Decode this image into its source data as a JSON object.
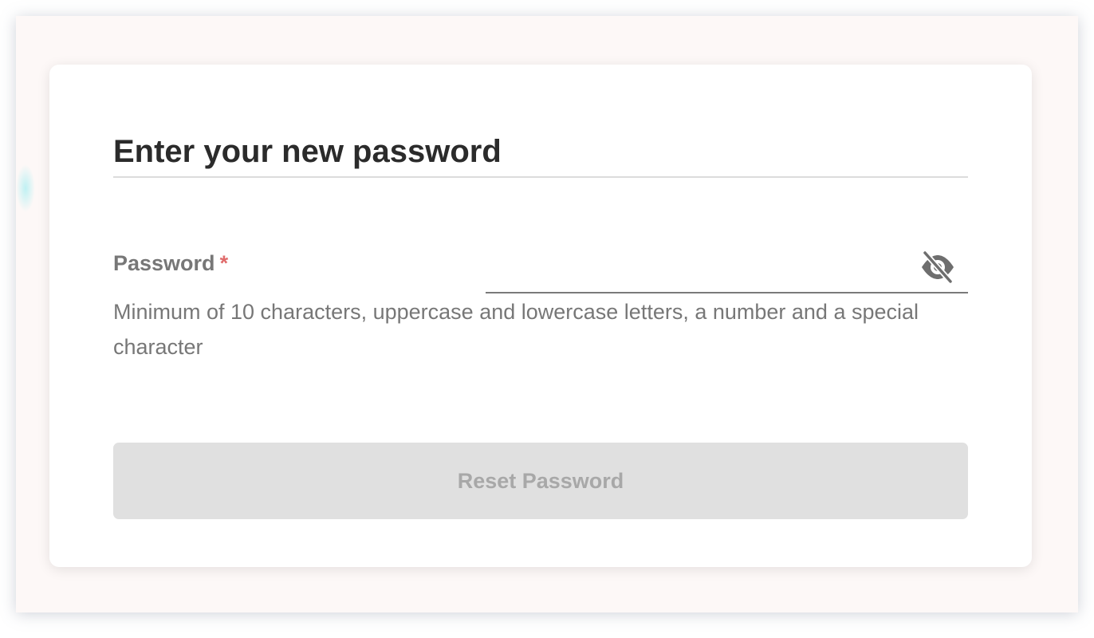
{
  "form": {
    "title": "Enter your new password",
    "password_label": "Password",
    "required_marker": "*",
    "password_value": "",
    "password_placeholder": "",
    "hint": "Minimum of 10 characters, uppercase and lowercase letters, a number and a special character",
    "submit_label": "Reset Password",
    "visibility_icon": "eye-slash-icon"
  },
  "colors": {
    "page_background": "#fdf8f7",
    "card_background": "#ffffff",
    "title_text": "#2b2b2b",
    "label_text": "#777777",
    "required_marker": "#e06b6b",
    "button_disabled_bg": "#e0e0e0",
    "button_disabled_text": "#a8a8a8"
  }
}
